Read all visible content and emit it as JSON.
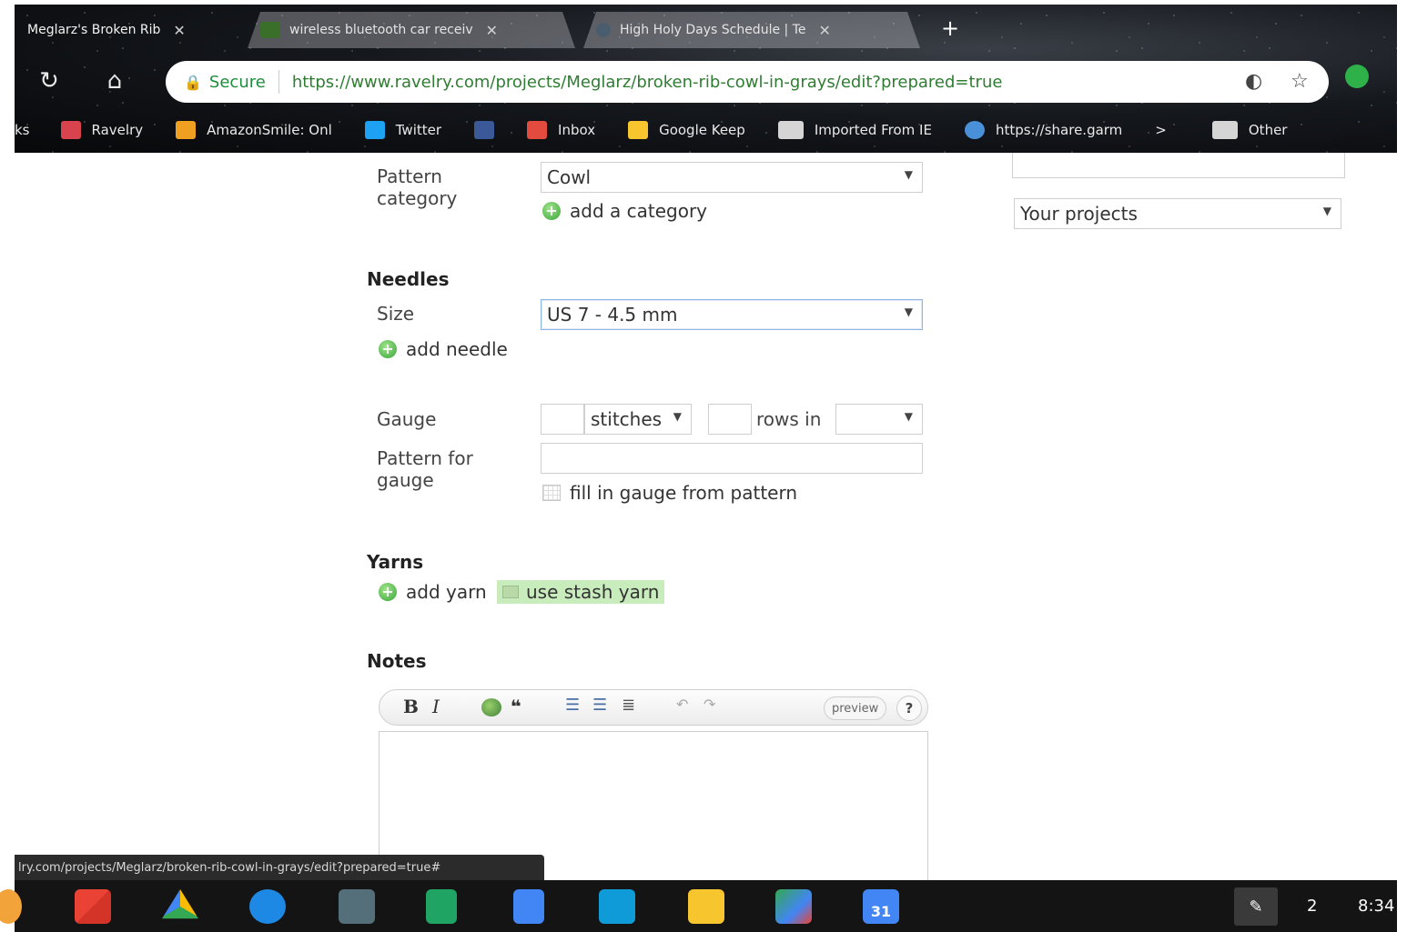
{
  "browser": {
    "tabs": [
      {
        "title": "Meglarz's Broken Rib",
        "close": "✕",
        "active": true
      },
      {
        "title": "wireless bluetooth car receiv",
        "close": "✕",
        "active": false
      },
      {
        "title": "High Holy Days Schedule | Te",
        "close": "✕",
        "active": false
      }
    ],
    "new_tab": "+",
    "secure_label": "Secure",
    "url": "https://www.ravelry.com/projects/Meglarz/broken-rib-cowl-in-grays/edit?prepared=true",
    "bookmarks": [
      {
        "label": "ks",
        "color": ""
      },
      {
        "label": "Ravelry",
        "color": "#d8434e"
      },
      {
        "label": "AmazonSmile: Onl",
        "color": "#f0a020"
      },
      {
        "label": "Twitter",
        "color": "#1da1f2"
      },
      {
        "label": "",
        "color": "#3b5998"
      },
      {
        "label": "Inbox",
        "color": "#e34b3e"
      },
      {
        "label": "Google Keep",
        "color": "#f7c52d"
      },
      {
        "label": "Imported From IE",
        "color": "#d5d5d5"
      },
      {
        "label": "https://share.garm",
        "color": "#4a90d9"
      },
      {
        "label": "Other",
        "color": "#d5d5d5"
      }
    ],
    "bookmark_overflow": ">"
  },
  "form": {
    "pattern_category_label": "Pattern category",
    "pattern_category_value": "Cowl",
    "add_category": "add a category",
    "sidebar_select_value": "Your projects",
    "needles_heading": "Needles",
    "size_label": "Size",
    "size_value": "US 7 - 4.5 mm",
    "add_needle": "add needle",
    "gauge_label": "Gauge",
    "gauge_stitches_value": "stitches",
    "gauge_rows_in": "rows in",
    "pattern_for_gauge_label": "Pattern for gauge",
    "fill_gauge": "fill in gauge from pattern",
    "yarns_heading": "Yarns",
    "add_yarn": "add yarn",
    "use_stash_yarn": "use stash yarn",
    "notes_heading": "Notes",
    "editor": {
      "bold": "B",
      "italic": "I",
      "quote": "❝",
      "preview": "preview",
      "help": "?"
    }
  },
  "status_url": "lry.com/projects/Meglarz/broken-rib-cowl-in-grays/edit?prepared=true#",
  "shelf": {
    "apps": [
      "gmail",
      "google-drive",
      "files",
      "file-manager",
      "sheets",
      "docs",
      "inbox",
      "keep",
      "maps",
      "calendar"
    ],
    "calendar_day": "31",
    "tray_count": "2",
    "time": "8:34"
  }
}
